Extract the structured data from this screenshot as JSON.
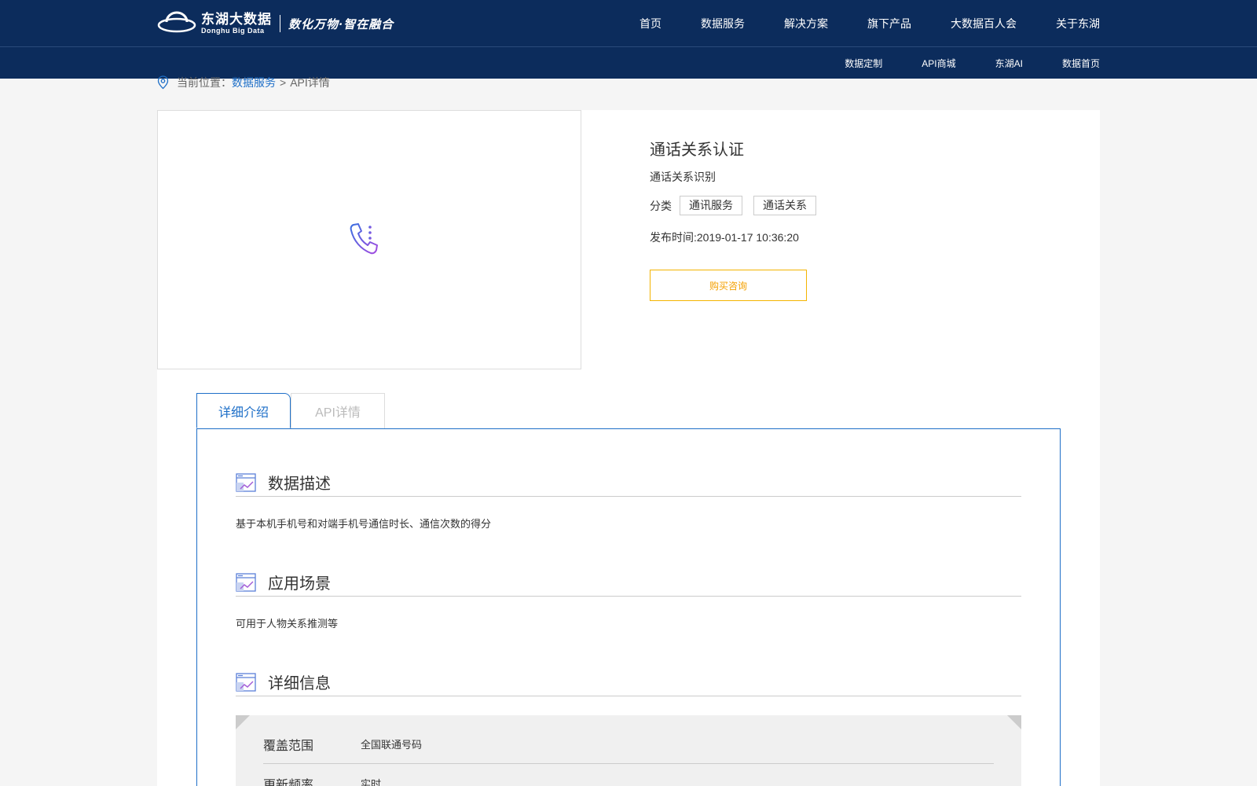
{
  "header": {
    "logo_main": "东湖大数据",
    "logo_sub": "Donghu Big Data",
    "slogan": "数化万物·智在融合",
    "nav": [
      "首页",
      "数据服务",
      "解决方案",
      "旗下产品",
      "大数据百人会",
      "关于东湖"
    ],
    "subnav": [
      "数据定制",
      "API商城",
      "东湖AI",
      "数据首页"
    ]
  },
  "breadcrumb": {
    "prefix": "当前位置：",
    "link": "数据服务",
    "separator": ">",
    "current": "API详情"
  },
  "product": {
    "title": "通话关系认证",
    "subtitle": "通话关系识别",
    "category_label": "分类",
    "tags": [
      "通讯服务",
      "通话关系"
    ],
    "publish_time": "发布时间:2019-01-17 10:36:20",
    "buy_label": "购买咨询",
    "icon": "phone-list-icon"
  },
  "tabs": {
    "active": "详细介绍",
    "inactive": "API详情"
  },
  "sections": {
    "desc_title": "数据描述",
    "desc_text": "基于本机手机号和对端手机号通信时长、通信次数的得分",
    "scene_title": "应用场景",
    "scene_text": "可用于人物关系推测等",
    "detail_title": "详细信息"
  },
  "details": [
    {
      "label": "覆盖范围",
      "value": "全国联通号码"
    },
    {
      "label": "更新频率",
      "value": "实时"
    }
  ],
  "colors": {
    "header_bg": "#0c2c5c",
    "accent": "#1e6fc8",
    "buy": "#f4a000"
  }
}
